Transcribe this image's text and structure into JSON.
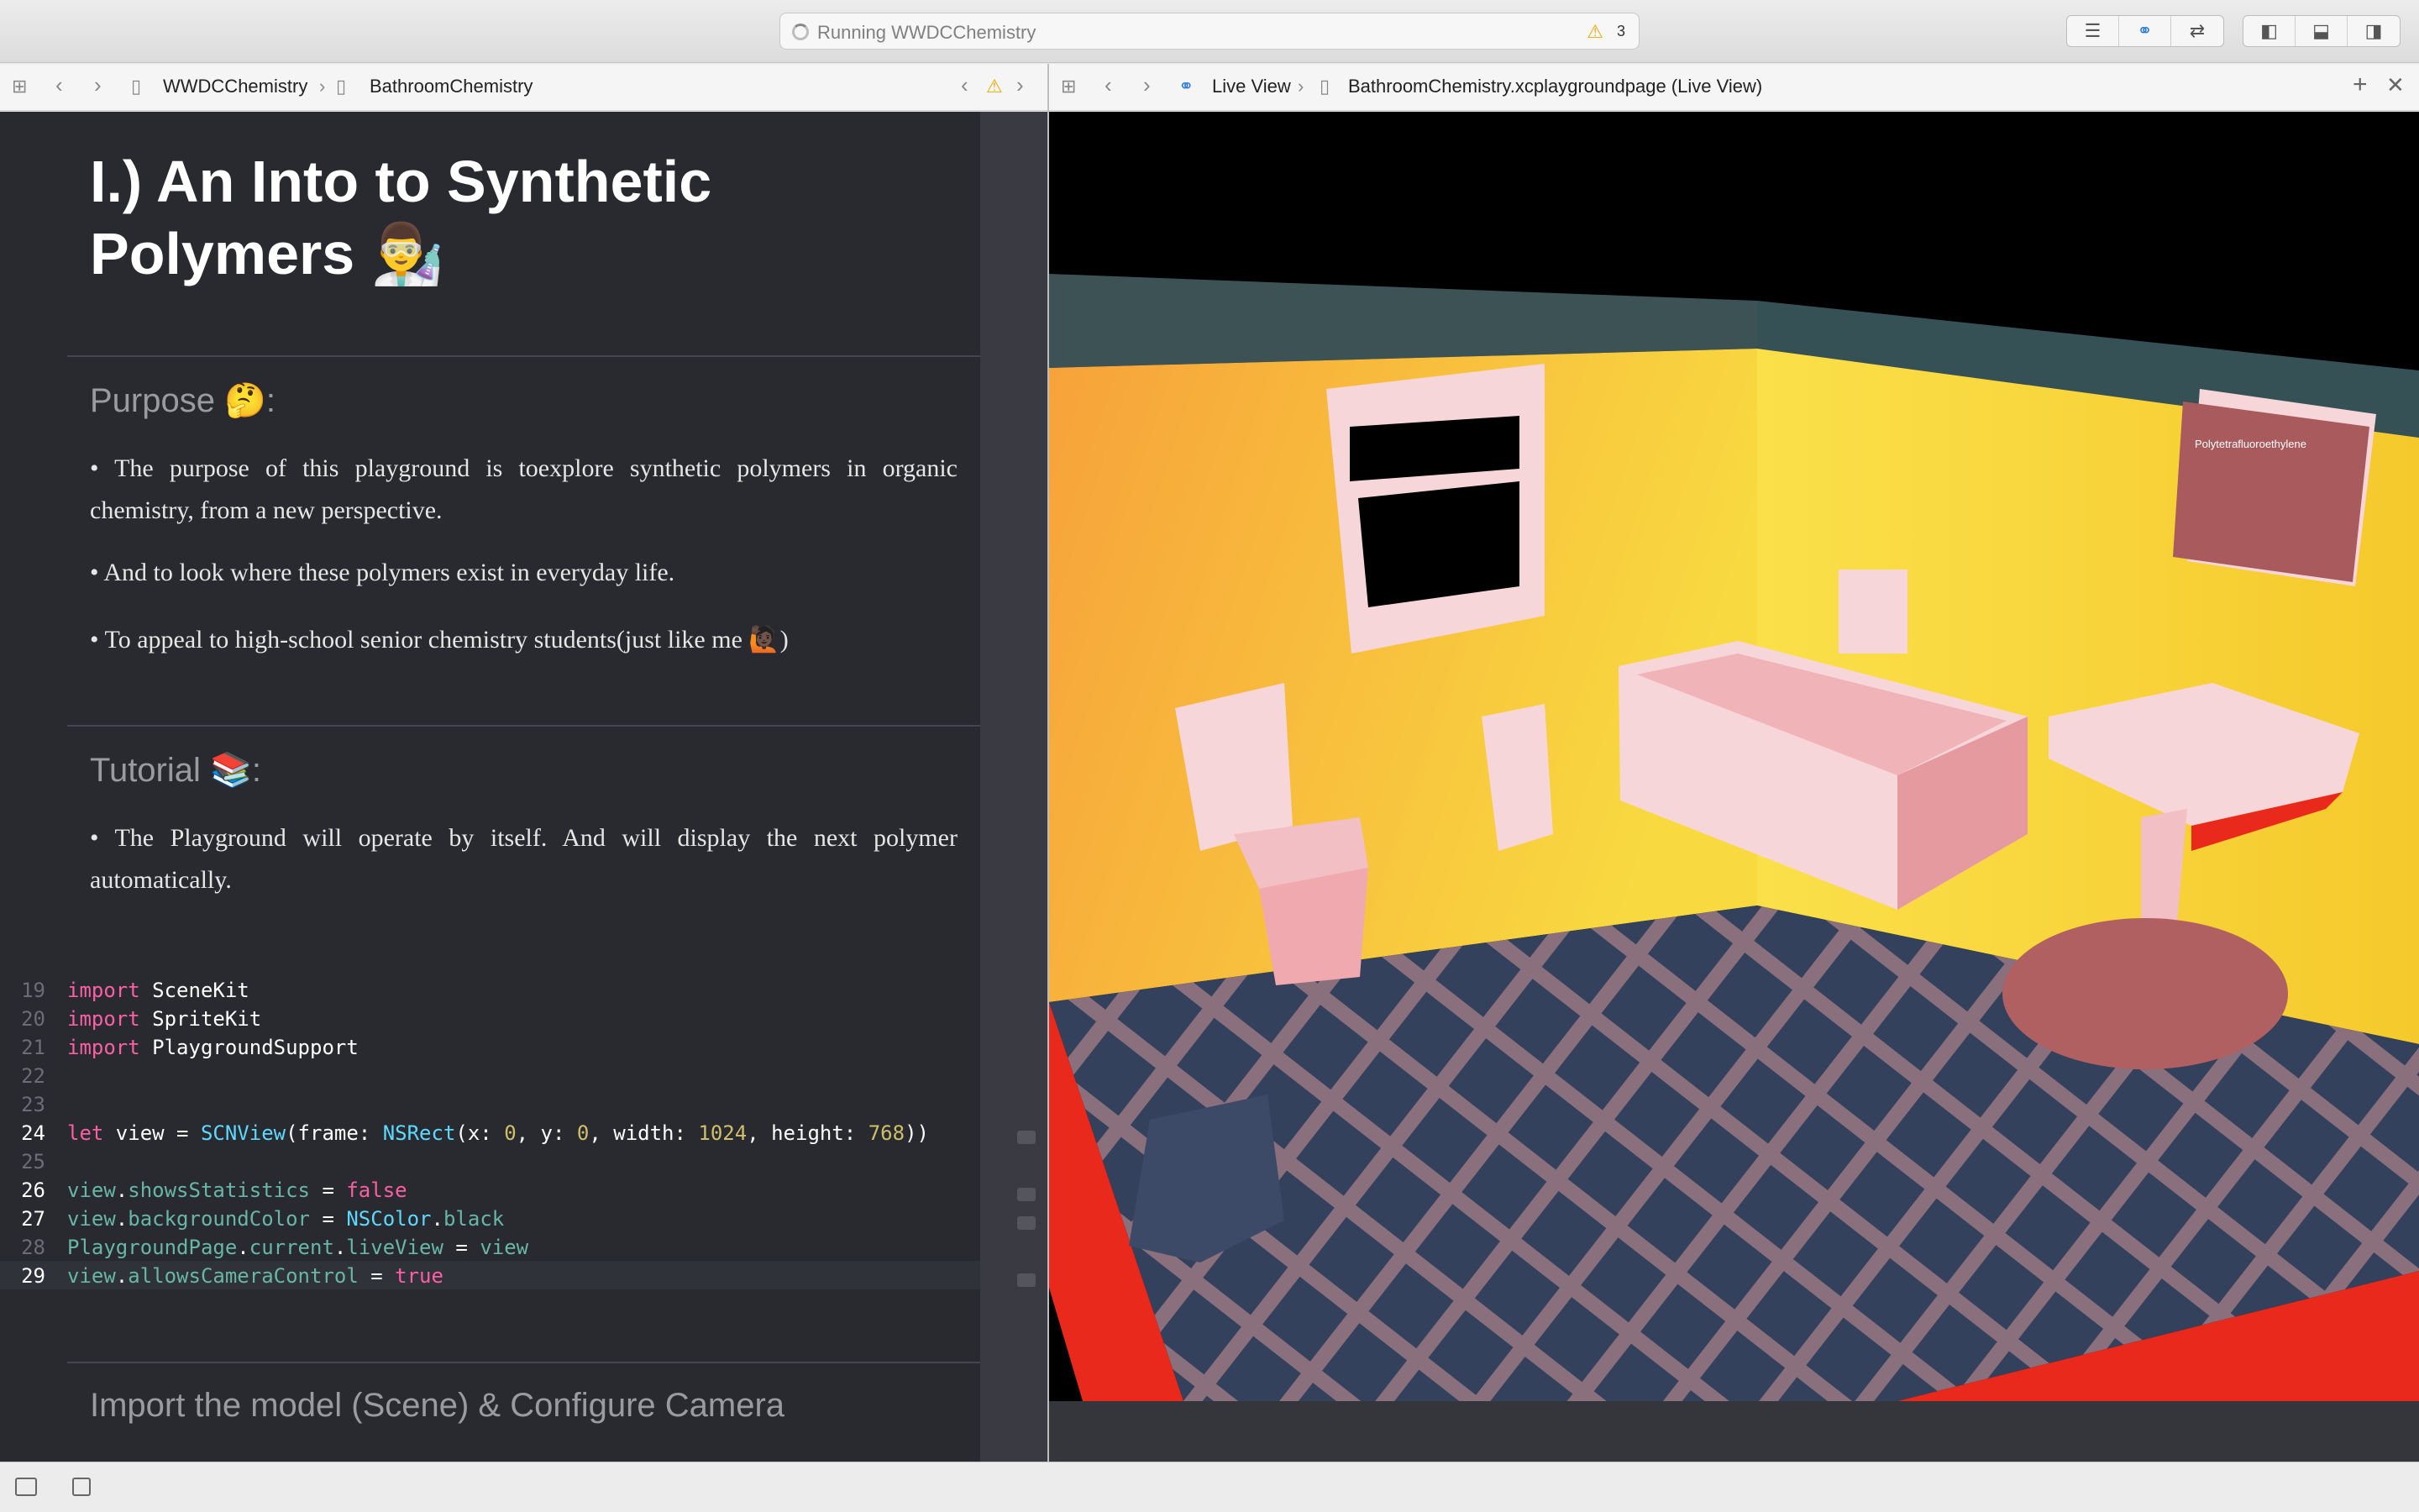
{
  "toolbar": {
    "activity_status": "Running WWDCChemistry",
    "warning_count": "3"
  },
  "left_jumpbar": {
    "project": "WWDCChemistry",
    "file": "BathroomChemistry"
  },
  "right_jumpbar": {
    "mode": "Live View",
    "file": "BathroomChemistry.xcplaygroundpage (Live View)"
  },
  "markup": {
    "title": "I.) An Into to Synthetic Polymers 👨‍🔬",
    "purpose_heading": "Purpose 🤔:",
    "purpose_bullets": [
      "• The purpose of this playground is toexplore synthetic polymers in organic chemistry, from a new perspective.",
      "• And to look where these polymers exist in everyday life.",
      "• To appeal to high-school senior chemistry students(just like me 🙋🏿)"
    ],
    "tutorial_heading": "Tutorial 📚:",
    "tutorial_bullets": [
      "• The Playground will operate by itself. And will display the next polymer automatically."
    ],
    "next_heading": "Import the model (Scene) & Configure Camera"
  },
  "code": {
    "line_numbers": [
      "19",
      "20",
      "21",
      "22",
      "23",
      "24",
      "25",
      "26",
      "27",
      "28",
      "29"
    ],
    "current_line": "29"
  },
  "scene": {
    "poster_title": "Polytetrafluoroethylene",
    "colors": {
      "wall": "#f5c536",
      "floor_tile": "#33415c",
      "grout": "#8a6f7c",
      "base": "#e8291c",
      "fixture": "#f7d6da"
    }
  },
  "icons": [
    "grid-icon",
    "chevron-left-icon",
    "chevron-right-icon",
    "swift-file-icon",
    "warning-icon",
    "editor-standard-icon",
    "editor-assistant-icon",
    "editor-version-icon",
    "navigator-toggle-icon",
    "debug-toggle-icon",
    "inspector-toggle-icon",
    "add-icon",
    "close-icon",
    "live-view-icon",
    "console-toggle-icon",
    "stop-icon"
  ]
}
